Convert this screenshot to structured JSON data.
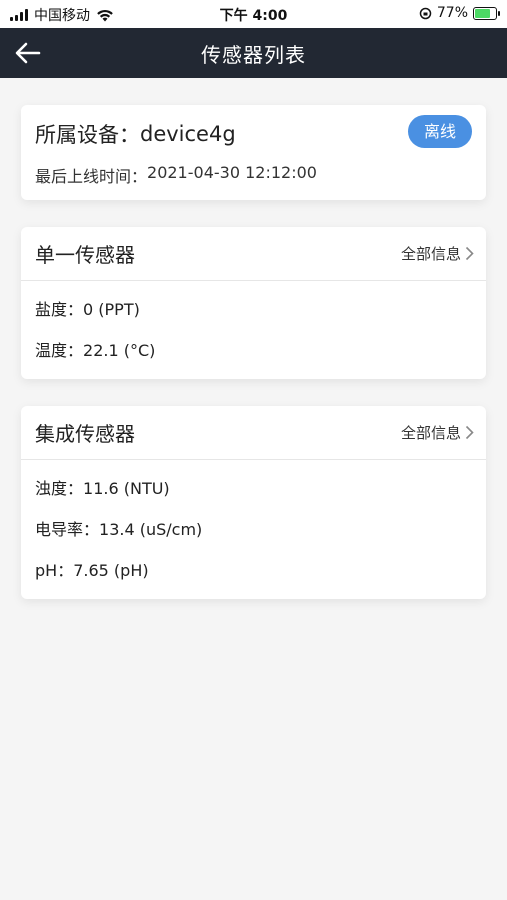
{
  "status_bar": {
    "carrier": "中国移动",
    "time": "下午 4:00",
    "battery": "77%",
    "battery_level": 0.77
  },
  "nav": {
    "title": "传感器列表",
    "back_icon": "arrow-left-icon"
  },
  "device": {
    "label": "所属设备：",
    "name": "device4g",
    "status": "离线",
    "status_color": "#4a90e2",
    "last_online_label": "最后上线时间：",
    "last_online_value": "2021-04-30 12:12:00"
  },
  "sensors": [
    {
      "title": "单一传感器",
      "more": "全部信息",
      "readings": [
        {
          "label": "盐度：",
          "value": "0 (PPT)"
        },
        {
          "label": "温度：",
          "value": "22.1 (°C)"
        }
      ]
    },
    {
      "title": "集成传感器",
      "more": "全部信息",
      "readings": [
        {
          "label": "浊度：",
          "value": "11.6 (NTU)"
        },
        {
          "label": "电导率：",
          "value": "13.4 (uS/cm)"
        },
        {
          "label": "pH：",
          "value": "7.65 (pH)"
        }
      ]
    }
  ],
  "colors": {
    "nav_bg": "#222833",
    "page_bg": "#f5f5f5",
    "accent": "#4a90e2"
  }
}
